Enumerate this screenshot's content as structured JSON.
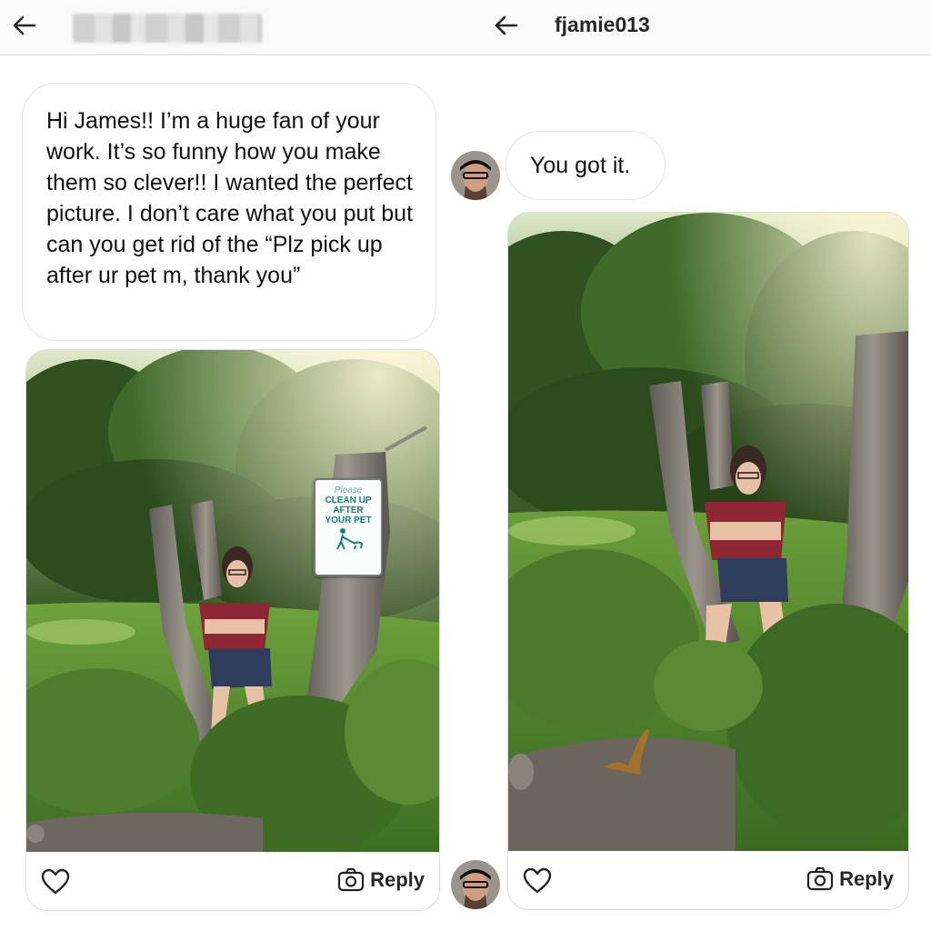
{
  "left": {
    "message": "Hi James!! I’m a huge fan of your work. It’s so funny how you make them so clever!! I wanted the perfect picture. I don’t care what you put but can you get rid of the “Plz pick up after ur pet m, thank you”",
    "sign": {
      "please": "Please",
      "line1": "CLEAN UP",
      "line2": "AFTER",
      "line3": "YOUR PET"
    },
    "reply_label": "Reply"
  },
  "right": {
    "username": "fjamie013",
    "message": "You got it.",
    "reply_label": "Reply"
  },
  "icons": {
    "back": "arrow-left-icon",
    "like": "heart-icon",
    "reply": "camera-icon"
  },
  "colors": {
    "bubble_border": "#e3e3e3",
    "topbar_bg": "#fafafa",
    "sign_text": "#1c7d72"
  }
}
